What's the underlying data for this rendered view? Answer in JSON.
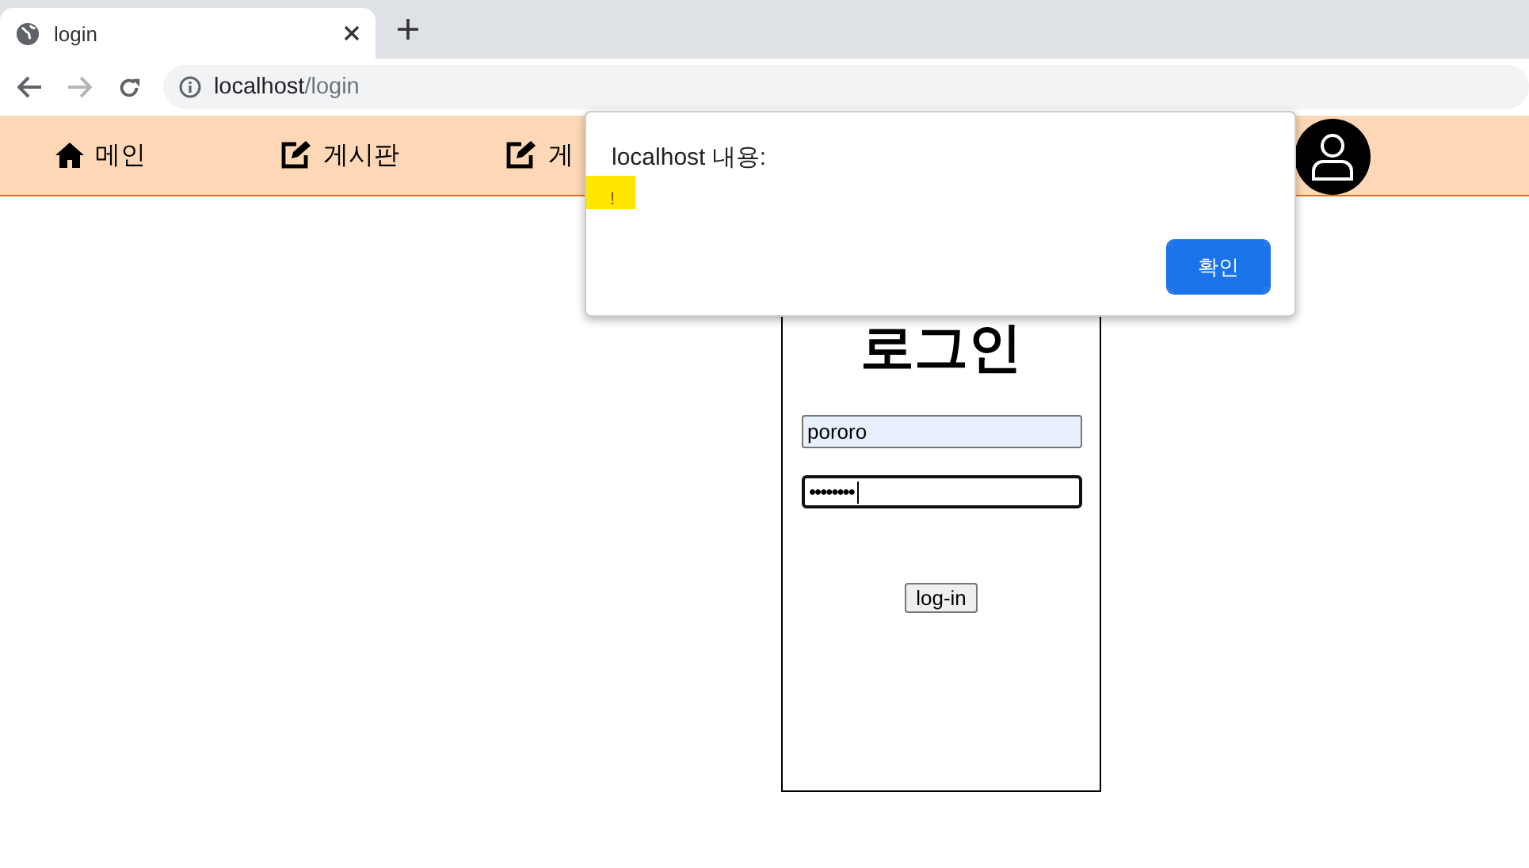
{
  "browser": {
    "tab_title": "login",
    "url_host": "localhost",
    "url_path": "/login"
  },
  "nav": {
    "items": [
      {
        "label": "메인",
        "kind": "home"
      },
      {
        "label": "게시판",
        "kind": "edit"
      },
      {
        "label": "게",
        "kind": "edit"
      }
    ]
  },
  "login": {
    "title": "로그인",
    "username": "pororo",
    "password": "••••••••",
    "button": "log-in"
  },
  "dialog": {
    "title": "localhost 내용:",
    "message": "!",
    "ok": "확인"
  }
}
